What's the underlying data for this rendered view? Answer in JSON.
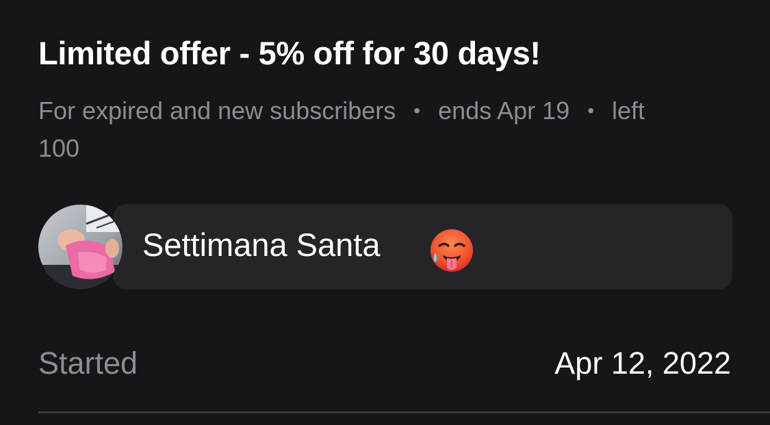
{
  "offer": {
    "title": "Limited offer - 5% off for 30 days!",
    "audience": "For expired and new subscribers",
    "separator": "•",
    "ends": "ends Apr 19",
    "left_label": "left",
    "left_count": "100"
  },
  "message": {
    "text": "Settimana Santa",
    "emoji_icon": "hot-face-icon"
  },
  "details": {
    "started_label": "Started",
    "started_value": "Apr 12, 2022"
  },
  "colors": {
    "background": "#161618",
    "bubble": "#252529",
    "primary_text": "#ffffff",
    "secondary_text": "#8a8d93",
    "divider": "#3a3a3f"
  }
}
